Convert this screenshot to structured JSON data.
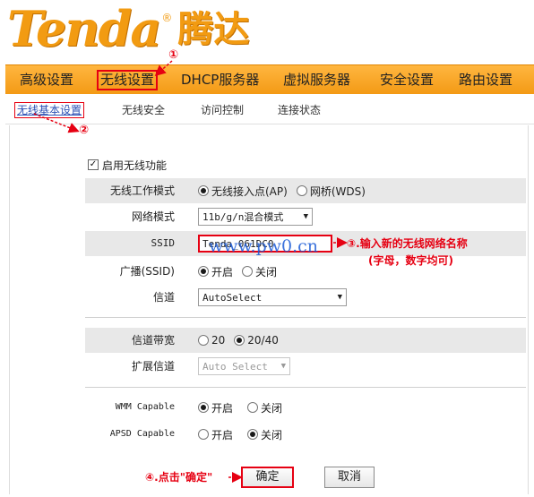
{
  "header": {
    "logo_latin": "Tenda",
    "logo_reg": "®",
    "logo_cn": "腾达"
  },
  "nav": {
    "items": [
      "高级设置",
      "无线设置",
      "DHCP服务器",
      "虚拟服务器",
      "安全设置",
      "路由设置"
    ],
    "active_index": 1
  },
  "subnav": {
    "items": [
      "无线基本设置",
      "无线安全",
      "访问控制",
      "连接状态"
    ],
    "active_index": 0
  },
  "form": {
    "enable_label": "启用无线功能",
    "enable_checked": true,
    "mode": {
      "label": "无线工作模式",
      "options": [
        "无线接入点(AP)",
        "网桥(WDS)"
      ],
      "selected": 0
    },
    "network_mode": {
      "label": "网络模式",
      "value": "11b/g/n混合模式"
    },
    "ssid": {
      "label": "SSID",
      "value": "Tenda_061DC0"
    },
    "broadcast": {
      "label": "广播(SSID)",
      "options": [
        "开启",
        "关闭"
      ],
      "selected": 0
    },
    "channel": {
      "label": "信道",
      "value": "AutoSelect"
    },
    "bandwidth": {
      "label": "信道带宽",
      "options": [
        "20",
        "20/40"
      ],
      "selected": 1
    },
    "ext_channel": {
      "label": "扩展信道",
      "value": "Auto Select"
    },
    "wmm": {
      "label": "WMM Capable",
      "options": [
        "开启",
        "关闭"
      ],
      "selected": 0
    },
    "apsd": {
      "label": "APSD Capable",
      "options": [
        "开启",
        "关闭"
      ],
      "selected": 1
    }
  },
  "buttons": {
    "ok": "确定",
    "cancel": "取消"
  },
  "annotations": {
    "step1": "①",
    "step2": "②",
    "step3": "③.输入新的无线网络名称",
    "step3_sub": "(字母，数字均可)",
    "step4": "④.点击\"确定\""
  },
  "watermark": "www.pw0.cn",
  "colors": {
    "accent": "#f39a15",
    "highlight": "#e60012",
    "link": "#2c50b4"
  }
}
